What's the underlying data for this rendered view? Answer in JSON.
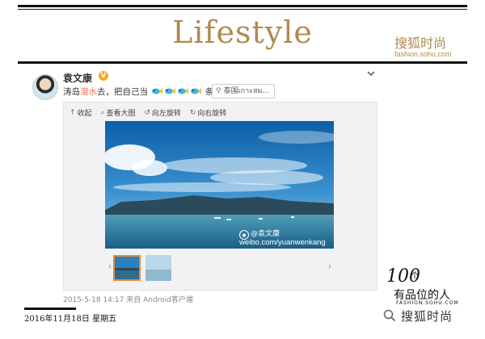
{
  "header": {
    "title": "Lifestyle",
    "brand_cn": "搜狐时尚",
    "brand_url": "fashion.sohu.com"
  },
  "post": {
    "username": "袁文康",
    "verified_badge": "V",
    "text_before": "涛岛",
    "text_highlight": "潜水",
    "text_after": "去，把自己当",
    "text_end": "条鱼。",
    "location": "泰国เกาะสม...",
    "toolbar": {
      "collapse": "收起",
      "view_large": "查看大图",
      "rotate_left": "向左旋转",
      "rotate_right": "向右旋转"
    },
    "watermark_name": "@袁文康",
    "watermark_url": "weibo.com/yuanwenkang",
    "meta": "2015-5-18 14:17 来自 Android客户端"
  },
  "footer": {
    "logo_number": "100",
    "logo_unit": "个",
    "logo_text": "有品位的人",
    "logo_url": "FASHION.SOHU.COM",
    "date": "2016年11月18日 星期五",
    "wechat_name": "搜狐时尚"
  },
  "icons": {
    "collapse": "collapse-arrow-icon",
    "view_large": "magnifier-icon",
    "rotate_left": "rotate-left-icon",
    "rotate_right": "rotate-right-icon",
    "location": "location-pin-icon",
    "fish": "fish-emoji-icon",
    "wechat": "wechat-search-icon"
  },
  "colors": {
    "gold": "#b08a4f",
    "highlight": "#eb7350",
    "badge": "#f5a623",
    "thumb_border": "#e58b3a"
  }
}
